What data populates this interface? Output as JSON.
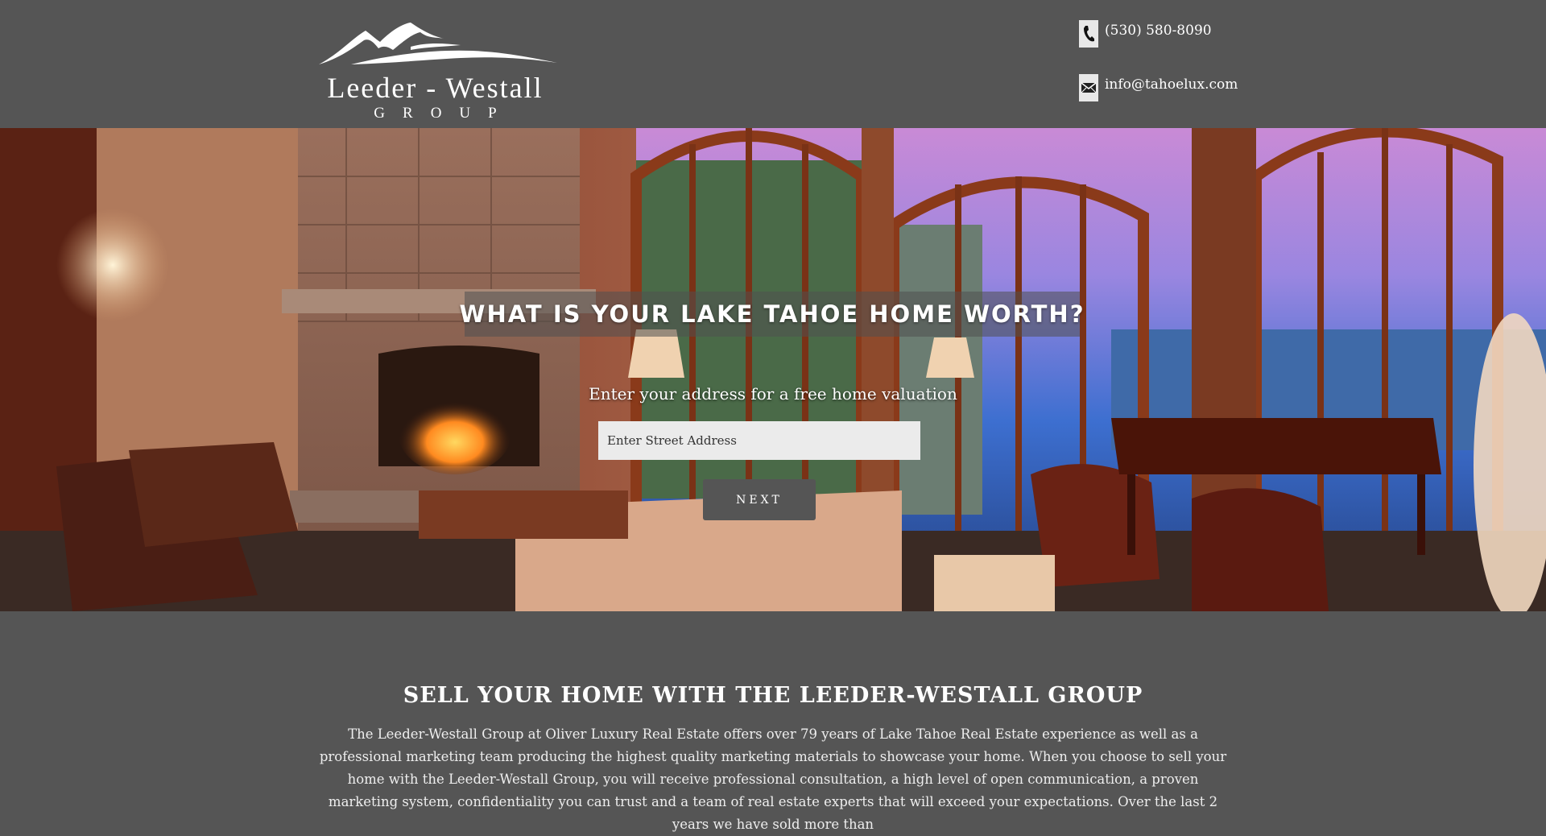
{
  "header": {
    "logo": {
      "name": "Leeder - Westall",
      "group": "GROUP"
    },
    "phone": "(530) 580-8090",
    "email": "info@tahoelux.com",
    "phone_icon": "phone-icon",
    "email_icon": "envelope-icon"
  },
  "hero": {
    "title": "WHAT IS YOUR LAKE TAHOE HOME WORTH?",
    "subtitle": "Enter your address for a free home valuation",
    "address_placeholder": "Enter Street Address",
    "address_value": "",
    "next_label": "NEXT"
  },
  "sell_section": {
    "title": "SELL YOUR HOME WITH THE LEEDER-WESTALL GROUP",
    "body": "The Leeder-Westall Group at Oliver Luxury Real Estate offers over 79 years of Lake Tahoe Real Estate experience as well as a professional marketing team producing the highest quality marketing materials to showcase your home.  When you choose to sell your home with the Leeder-Westall Group, you will receive professional consultation, a high level of open communication, a proven marketing system, confidentiality you can trust and a team of real estate experts that will exceed your expectations. Over the last 2 years we have sold more than"
  },
  "colors": {
    "background": "#555555",
    "input_background": "#ebebeb",
    "button_background": "#555555",
    "text": "#ffffff"
  }
}
